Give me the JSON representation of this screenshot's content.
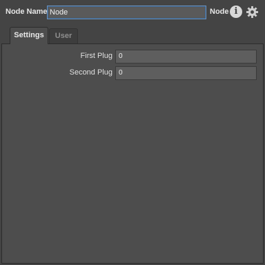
{
  "header": {
    "node_name_label": "Node Name",
    "node_name_value": "Node",
    "node_type_label": "Node"
  },
  "icons": {
    "info": "info-icon",
    "settings": "gear-icon"
  },
  "tabs": [
    {
      "label": "Settings",
      "active": true
    },
    {
      "label": "User",
      "active": false
    }
  ],
  "settings": {
    "plugs": [
      {
        "label": "First Plug",
        "value": "0"
      },
      {
        "label": "Second Plug",
        "value": "0"
      }
    ]
  },
  "colors": {
    "background": "#444444",
    "panel": "#4d4d4d",
    "input_focus_border": "#6d93bd"
  }
}
